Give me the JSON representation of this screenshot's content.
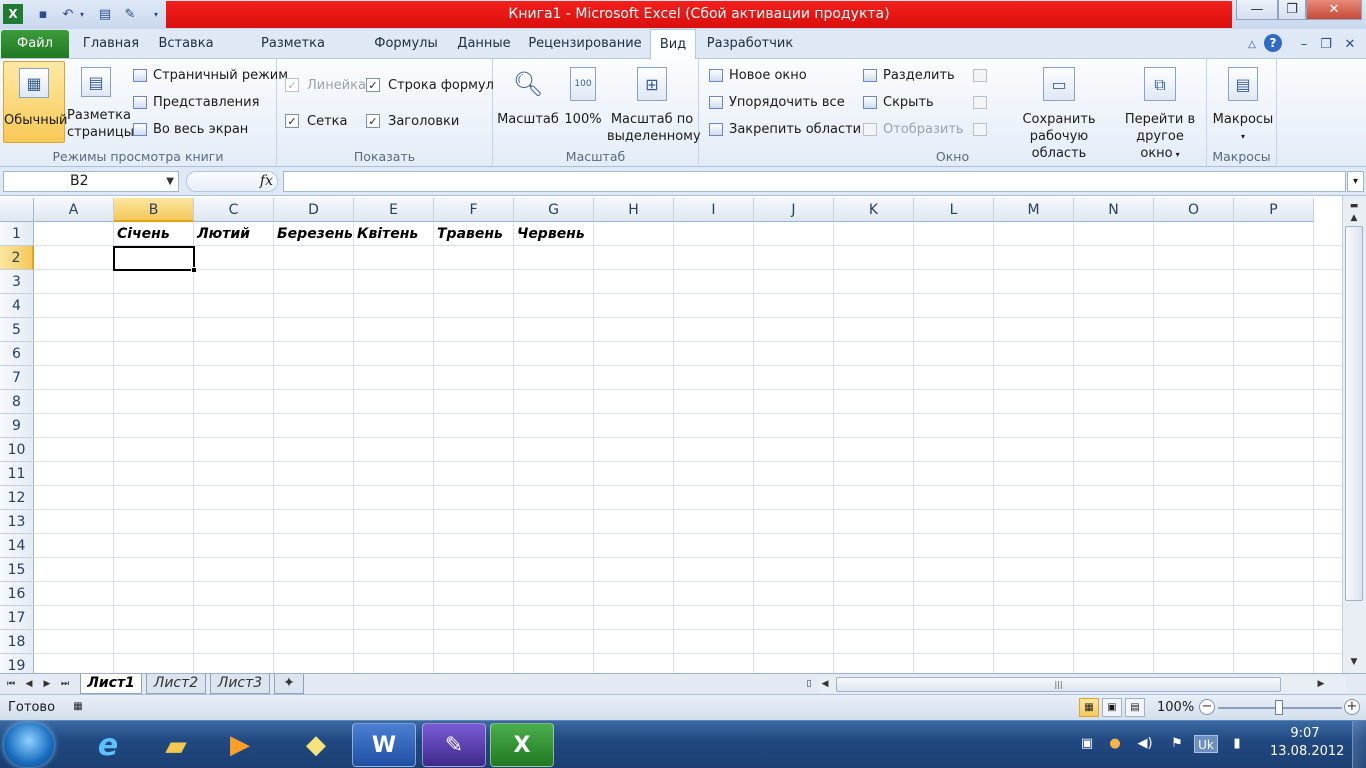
{
  "window": {
    "title": "Книга1  -  Microsoft Excel (Сбой активации продукта)"
  },
  "ribbon_tabs": [
    "Файл",
    "Главная",
    "Вставка",
    "Разметка страницы",
    "Формулы",
    "Данные",
    "Рецензирование",
    "Вид",
    "Разработчик"
  ],
  "active_tab": "Вид",
  "ribbon": {
    "views": {
      "label": "Режимы просмотра книги",
      "normal": "Обычный",
      "page_layout_1": "Разметка",
      "page_layout_2": "страницы",
      "page_break": "Страничный режим",
      "custom_views": "Представления",
      "full_screen": "Во весь экран"
    },
    "show": {
      "label": "Показать",
      "ruler": "Линейка",
      "formula_bar": "Строка формул",
      "gridlines": "Сетка",
      "headings": "Заголовки",
      "ruler_checked": true,
      "formula_bar_checked": true,
      "gridlines_checked": true,
      "headings_checked": true
    },
    "zoom": {
      "label": "Масштаб",
      "zoom": "Масштаб",
      "zoom100": "100%",
      "zoom_sel_1": "Масштаб по",
      "zoom_sel_2": "выделенному"
    },
    "window": {
      "label": "Окно",
      "new_window": "Новое окно",
      "arrange_all": "Упорядочить все",
      "freeze": "Закрепить области",
      "split": "Разделить",
      "hide": "Скрыть",
      "unhide": "Отобразить",
      "save_ws_1": "Сохранить",
      "save_ws_2": "рабочую область",
      "switch_1": "Перейти в",
      "switch_2": "другое окно"
    },
    "macros": {
      "label": "Макросы",
      "macros": "Макросы"
    }
  },
  "formula_bar": {
    "name_box": "B2",
    "fx": "fx",
    "value": ""
  },
  "sheet": {
    "columns": [
      "A",
      "B",
      "C",
      "D",
      "E",
      "F",
      "G",
      "H",
      "I",
      "J",
      "K",
      "L",
      "M",
      "N",
      "O",
      "P"
    ],
    "rows": [
      "1",
      "2",
      "3",
      "4",
      "5",
      "6",
      "7",
      "8",
      "9",
      "10",
      "11",
      "12",
      "13",
      "14",
      "15",
      "16",
      "17",
      "18",
      "19"
    ],
    "selected_column": "B",
    "selected_row": "2",
    "row1": [
      "",
      "Січень",
      "Лютий",
      "Березень",
      "Квітень",
      "Травень",
      "Червень"
    ]
  },
  "sheet_tabs": [
    "Лист1",
    "Лист2",
    "Лист3"
  ],
  "active_sheet": "Лист1",
  "status": {
    "ready": "Готово",
    "zoom": "100%"
  },
  "taskbar": {
    "time": "9:07",
    "date": "13.08.2012",
    "lang": "Uk"
  }
}
